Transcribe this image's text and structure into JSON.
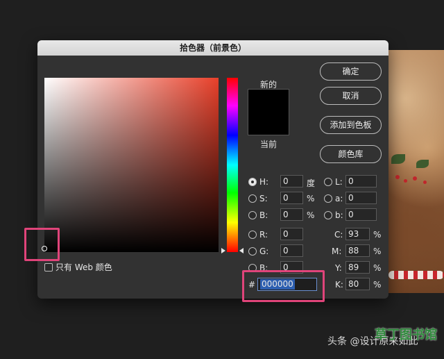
{
  "window": {
    "title": "拾色器（前景色）"
  },
  "preview": {
    "new_label": "新的",
    "current_label": "当前",
    "color": "#000000"
  },
  "buttons": {
    "ok": "确定",
    "cancel": "取消",
    "add_swatch": "添加到色板",
    "color_library": "颜色库"
  },
  "hsb": [
    {
      "label": "H:",
      "value": "0",
      "unit": "度",
      "selected": true
    },
    {
      "label": "S:",
      "value": "0",
      "unit": "%"
    },
    {
      "label": "B:",
      "value": "0",
      "unit": "%"
    }
  ],
  "lab": [
    {
      "label": "L:",
      "value": "0"
    },
    {
      "label": "a:",
      "value": "0"
    },
    {
      "label": "b:",
      "value": "0"
    }
  ],
  "rgb": [
    {
      "label": "R:",
      "value": "0"
    },
    {
      "label": "G:",
      "value": "0"
    },
    {
      "label": "B:",
      "value": "0"
    }
  ],
  "cmyk": [
    {
      "label": "C:",
      "value": "93",
      "unit": "%"
    },
    {
      "label": "M:",
      "value": "88",
      "unit": "%"
    },
    {
      "label": "Y:",
      "value": "89",
      "unit": "%"
    },
    {
      "label": "K:",
      "value": "80",
      "unit": "%"
    }
  ],
  "hex": {
    "prefix": "#",
    "value": "000000"
  },
  "web_only": {
    "label": "只有 Web 颜色"
  },
  "watermark": {
    "text": "头条 @设计原来如此",
    "logo": "草丁图书馆"
  },
  "colors": {
    "highlight": "#e0447a",
    "accent": "#2d5fb0"
  }
}
